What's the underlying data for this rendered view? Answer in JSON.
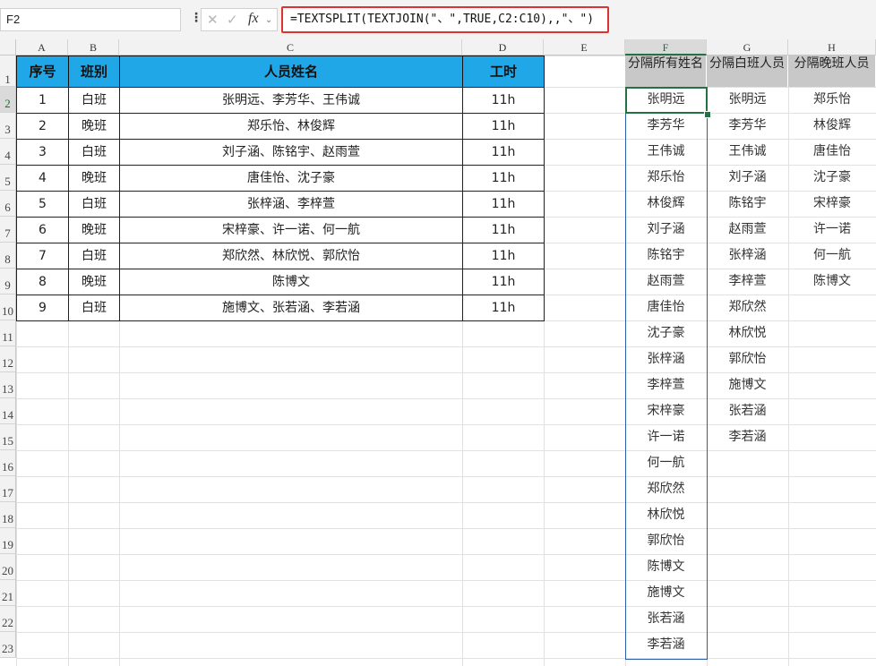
{
  "formula_bar": {
    "name_box": "F2",
    "formula": "=TEXTSPLIT(TEXTJOIN(\"、\",TRUE,C2:C10),,\"、\")",
    "cancel_glyph": "✕",
    "enter_glyph": "✓",
    "fx_label": "fx"
  },
  "columns": [
    "A",
    "B",
    "C",
    "D",
    "E",
    "F",
    "G",
    "H"
  ],
  "rows": [
    "1",
    "2",
    "3",
    "4",
    "5",
    "6",
    "7",
    "8",
    "9",
    "10",
    "11",
    "12",
    "13",
    "14",
    "15",
    "16",
    "17",
    "18",
    "19",
    "20",
    "21",
    "22",
    "23"
  ],
  "table": {
    "headers": [
      "序号",
      "班别",
      "人员姓名",
      "工时"
    ],
    "rows": [
      [
        "1",
        "白班",
        "张明远、李芳华、王伟诚",
        "11h"
      ],
      [
        "2",
        "晚班",
        "郑乐怡、林俊辉",
        "11h"
      ],
      [
        "3",
        "白班",
        "刘子涵、陈铭宇、赵雨萱",
        "11h"
      ],
      [
        "4",
        "晚班",
        "唐佳怡、沈子豪",
        "11h"
      ],
      [
        "5",
        "白班",
        "张梓涵、李梓萱",
        "11h"
      ],
      [
        "6",
        "晚班",
        "宋梓豪、许一诺、何一航",
        "11h"
      ],
      [
        "7",
        "白班",
        "郑欣然、林欣悦、郭欣怡",
        "11h"
      ],
      [
        "8",
        "晚班",
        "陈博文",
        "11h"
      ],
      [
        "9",
        "白班",
        "施博文、张若涵、李若涵",
        "11h"
      ]
    ]
  },
  "split_headers": [
    "分隔所有姓名",
    "分隔白班人员",
    "分隔晚班人员"
  ],
  "all_names": [
    "张明远",
    "李芳华",
    "王伟诚",
    "郑乐怡",
    "林俊辉",
    "刘子涵",
    "陈铭宇",
    "赵雨萱",
    "唐佳怡",
    "沈子豪",
    "张梓涵",
    "李梓萱",
    "宋梓豪",
    "许一诺",
    "何一航",
    "郑欣然",
    "林欣悦",
    "郭欣怡",
    "陈博文",
    "施博文",
    "张若涵",
    "李若涵"
  ],
  "day_names": [
    "张明远",
    "李芳华",
    "王伟诚",
    "刘子涵",
    "陈铭宇",
    "赵雨萱",
    "张梓涵",
    "李梓萱",
    "郑欣然",
    "林欣悦",
    "郭欣怡",
    "施博文",
    "张若涵",
    "李若涵"
  ],
  "night_names": [
    "郑乐怡",
    "林俊辉",
    "唐佳怡",
    "沈子豪",
    "宋梓豪",
    "许一诺",
    "何一航",
    "陈博文"
  ],
  "colors": {
    "header_fill": "#1fa7e8",
    "selection": "#217346",
    "spill_border": "#2b5fa8",
    "formula_border": "#e03131"
  }
}
